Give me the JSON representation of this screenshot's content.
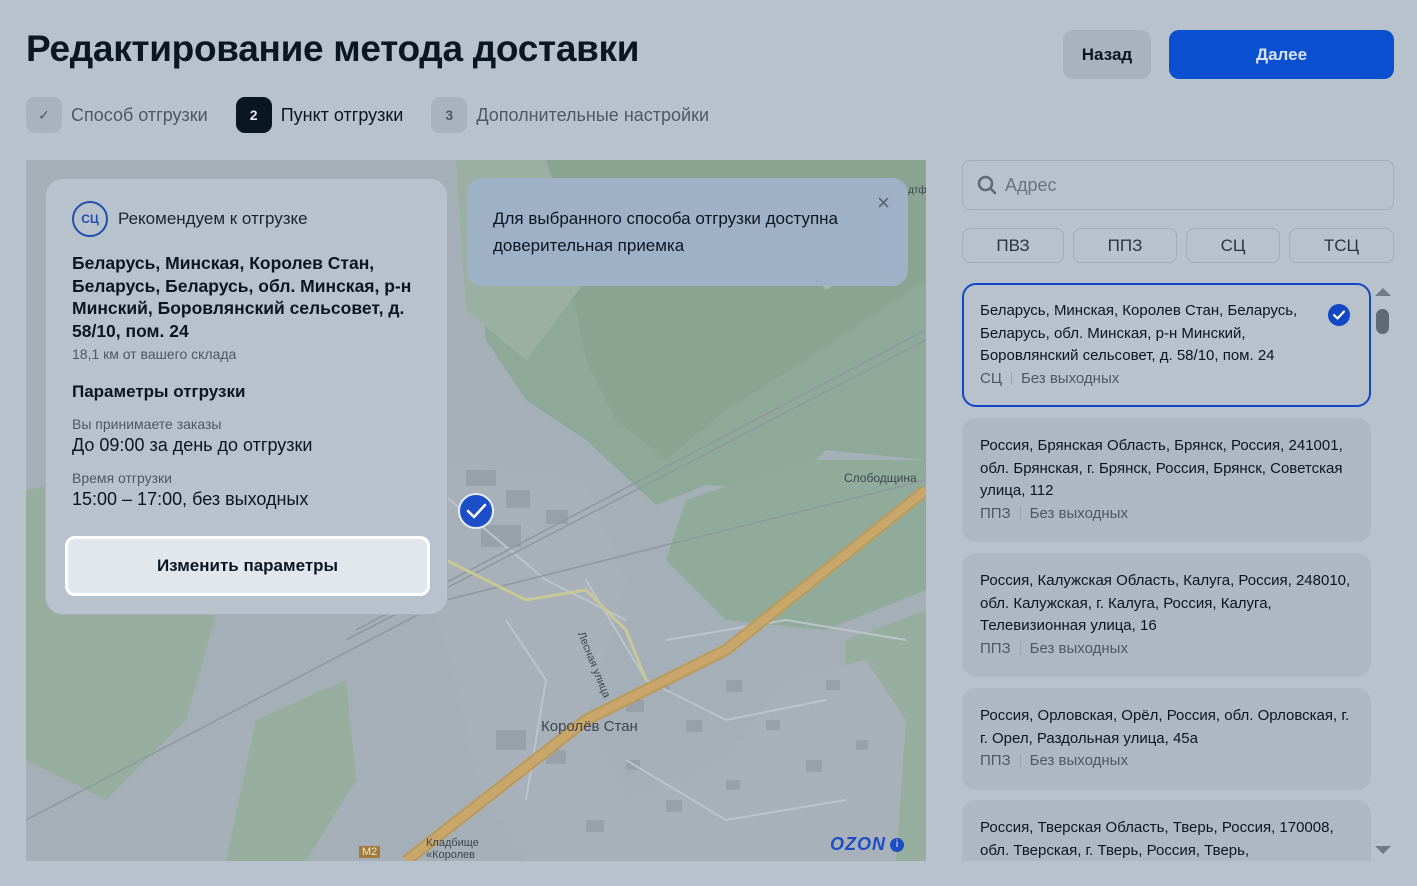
{
  "header": {
    "title": "Редактирование метода доставки",
    "back_label": "Назад",
    "next_label": "Далее"
  },
  "stepper": {
    "steps": [
      {
        "badge": "✓",
        "label": "Способ отгрузки",
        "state": "done"
      },
      {
        "badge": "2",
        "label": "Пункт отгрузки",
        "state": "active"
      },
      {
        "badge": "3",
        "label": "Дополнительные настройки",
        "state": "pending"
      }
    ]
  },
  "map": {
    "labels": {
      "sloboda": "Слободщина",
      "lesnaya": "Лесная улица",
      "korolev": "Королёв Стан",
      "m2": "М2",
      "cemetery_line1": "Кладбище",
      "cemetery_line2": "«Королев",
      "edge_text": "дтф"
    },
    "brand": "OZON",
    "info_icon": "i"
  },
  "recommendation": {
    "logo_text": "СЦ",
    "title": "Рекомендуем к отгрузке",
    "address": "Беларусь, Минская, Королев Стан, Беларусь, Беларусь, обл. Минская, р-н Минский, Боровлянский сельсовет, д. 58/10, пом. 24",
    "distance": "18,1 км от вашего склада",
    "params_title": "Параметры отгрузки",
    "orders_label": "Вы принимаете заказы",
    "orders_value": "До 09:00 за день до отгрузки",
    "time_label": "Время отгрузки",
    "time_value": "15:00 – 17:00, без выходных",
    "change_button": "Изменить параметры"
  },
  "notice": {
    "text": "Для выбранного способа отгрузки доступна доверительная приемка",
    "close_icon": "×"
  },
  "search": {
    "placeholder": "Адрес",
    "value": ""
  },
  "filters": [
    "ПВЗ",
    "ППЗ",
    "СЦ",
    "ТСЦ"
  ],
  "points": [
    {
      "address": "Беларусь, Минская, Королев Стан, Беларусь, Беларусь, обл. Минская, р-н Минский, Боровлянский сельсовет, д. 58/10, пом. 24",
      "type": "СЦ",
      "schedule": "Без выходных",
      "selected": true
    },
    {
      "address": "Россия, Брянская Область, Брянск, Россия, 241001, обл. Брянская, г. Брянск, Россия, Брянск, Советская улица, 112",
      "type": "ППЗ",
      "schedule": "Без выходных",
      "selected": false
    },
    {
      "address": "Россия, Калужская Область, Калуга, Россия, 248010, обл. Калужская, г. Калуга, Россия, Калуга, Телевизионная улица, 16",
      "type": "ППЗ",
      "schedule": "Без выходных",
      "selected": false
    },
    {
      "address": "Россия, Орловская, Орёл, Россия, обл. Орловская, г. г. Орел, Раздольная улица, 45а",
      "type": "ППЗ",
      "schedule": "Без выходных",
      "selected": false
    },
    {
      "address": "Россия, Тверская Область, Тверь, Россия, 170008, обл. Тверская, г. Тверь, Россия, Тверь,",
      "type": "",
      "schedule": "",
      "selected": false
    }
  ],
  "colors": {
    "accent": "#0a4fd0",
    "selected_border": "#1247c6",
    "ozon_brand": "#1d4ec4"
  }
}
